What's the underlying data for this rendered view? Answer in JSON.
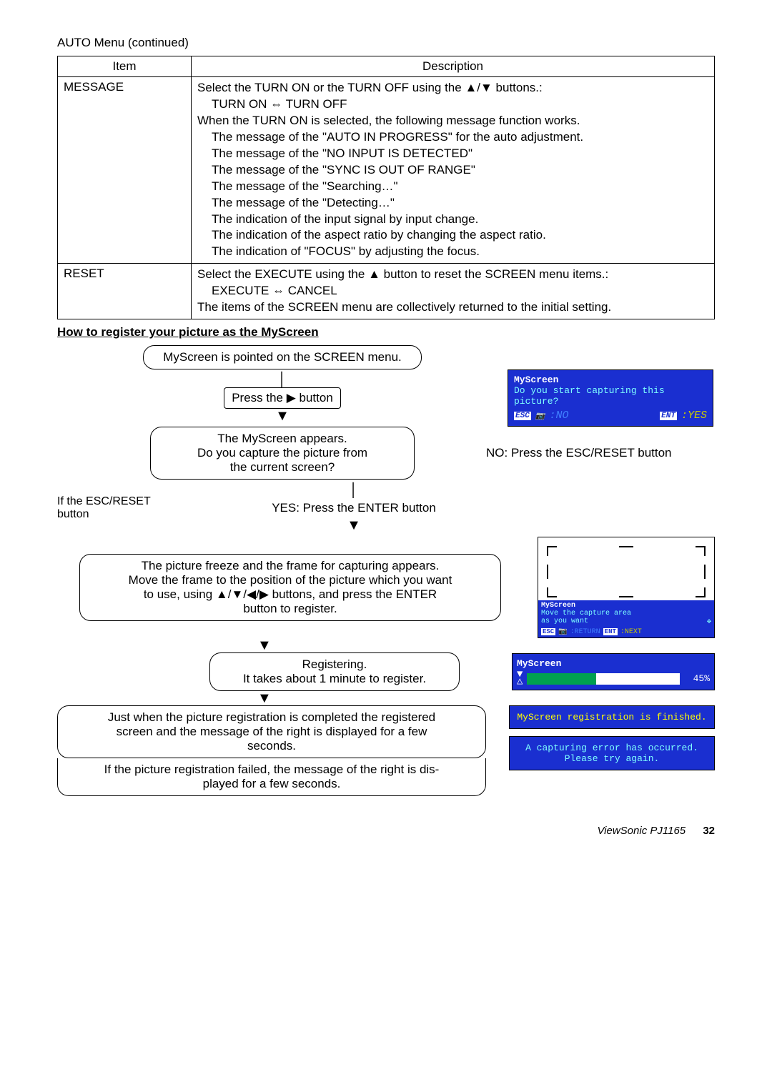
{
  "continued": "AUTO Menu (continued)",
  "table": {
    "headers": {
      "item": "Item",
      "desc": "Description"
    },
    "rows": [
      {
        "item": "MESSAGE",
        "lines": {
          "l1": "Select the TURN ON or the TURN OFF using the ▲/▼ buttons.:",
          "l1b": "TURN ON ⇔ TURN OFF",
          "l2": "When the TURN ON is selected, the following message function works.",
          "l3": "The message of the \"AUTO IN PROGRESS\" for the auto adjustment.",
          "l4": "The message of the \"NO INPUT IS DETECTED\"",
          "l5": "The message of the \"SYNC IS OUT OF RANGE\"",
          "l6": "The message of the \"Searching…\"",
          "l7": "The message of the \"Detecting…\"",
          "l8": "The indication of the input signal by input change.",
          "l9": "The indication of the aspect ratio by changing the aspect ratio.",
          "l10": "The indication of \"FOCUS\" by adjusting the focus."
        }
      },
      {
        "item": "RESET",
        "lines": {
          "l1": "Select the EXECUTE using the ▲ button to reset the SCREEN menu items.:",
          "l1b": "EXECUTE ⇔ CANCEL",
          "l2": "The items of the SCREEN menu are collectively returned to the initial setting."
        }
      }
    ]
  },
  "section_title": "How to register your picture as the MyScreen",
  "flow": {
    "b1": "MyScreen is pointed on the SCREEN menu.",
    "press_right": "Press the ▶ button",
    "b2a": "The MyScreen appears.",
    "b2b": "Do you capture the picture from",
    "b2c": "the current screen?",
    "no_label": "NO: Press the ESC/RESET button",
    "esc_label_a": "If the ESC/RESET",
    "esc_label_b": "button",
    "yes_label": "YES: Press the ENTER button",
    "b3a": "The picture freeze and the frame for capturing appears.",
    "b3b": "Move the frame to the position of the picture which you want",
    "b3c": "to use, using ▲/▼/◀/▶ buttons, and press the ENTER",
    "b3d": "button to register.",
    "b4a": "Registering.",
    "b4b": "It takes about 1 minute to register.",
    "b5a": "Just when the picture registration is completed the registered",
    "b5b": "screen and the message of the right is displayed for a few",
    "b5c": "seconds.",
    "b6a": "If the picture registration failed, the message of the right is dis-",
    "b6b": "played for a few seconds.",
    "dlg1_title": "MyScreen",
    "dlg1_msg": "Do you start capturing this picture?",
    "dlg1_esc": "ESC",
    "dlg1_no": ":NO",
    "dlg1_ent": "ENT",
    "dlg1_yes": ":YES",
    "capture_title": "MyScreen",
    "capture_msg1": "Move the capture area",
    "capture_msg2": "as you want",
    "capture_esc": "ESC",
    "capture_return": ":RETURN",
    "capture_ent": "ENT",
    "capture_next": ":NEXT",
    "prog_title": "MyScreen",
    "prog_percent": "45%",
    "done_msg": "MyScreen registration is finished.",
    "err_msg1": "A capturing error has occurred.",
    "err_msg2": "Please try again."
  },
  "footer": {
    "product": "ViewSonic  PJ1165",
    "page": "32"
  }
}
